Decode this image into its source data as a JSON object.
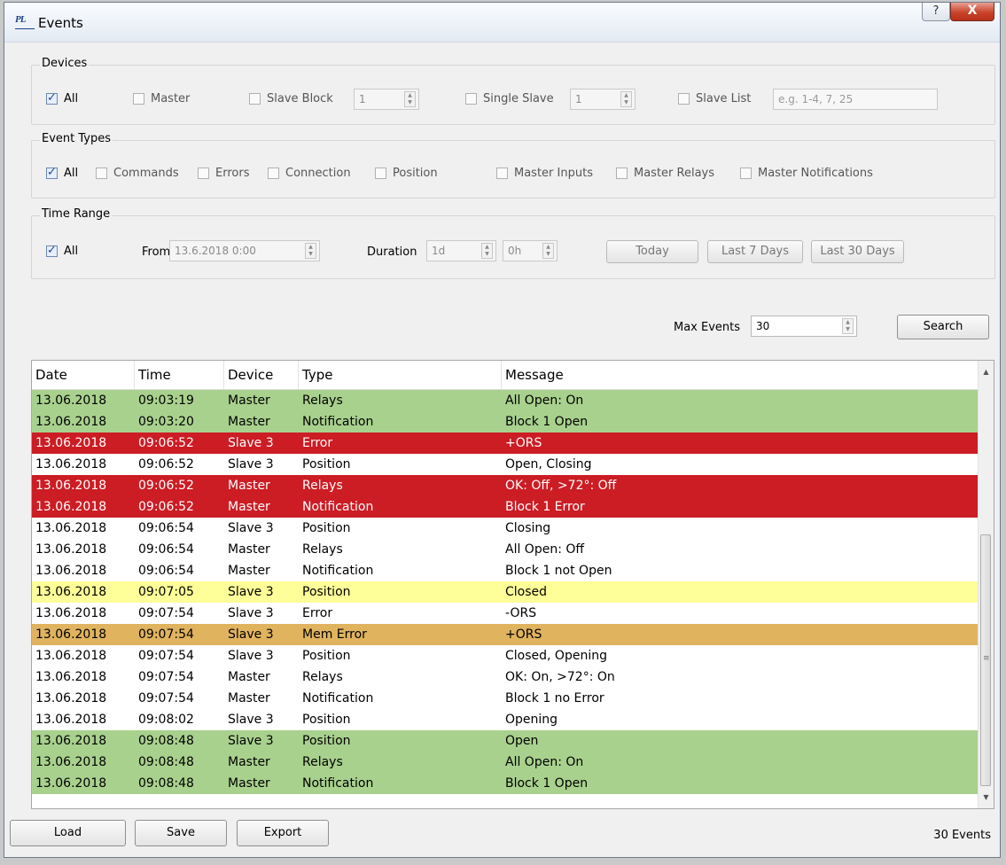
{
  "window": {
    "title": "Events",
    "logo_text": "PL",
    "help_label": "?",
    "close_label": "X"
  },
  "devices": {
    "label": "Devices",
    "all": "All",
    "master": "Master",
    "slave_block": "Slave Block",
    "slave_block_value": "1",
    "single_slave": "Single Slave",
    "single_slave_value": "1",
    "slave_list": "Slave List",
    "slave_list_placeholder": "e.g. 1-4, 7, 25"
  },
  "event_types": {
    "label": "Event Types",
    "all": "All",
    "commands": "Commands",
    "errors": "Errors",
    "connection": "Connection",
    "position": "Position",
    "master_inputs": "Master Inputs",
    "master_relays": "Master Relays",
    "master_notifications": "Master Notifications"
  },
  "time_range": {
    "label": "Time Range",
    "all": "All",
    "from_label": "From",
    "from_value": "13.6.2018 0:00",
    "duration_label": "Duration",
    "duration_days": "1d",
    "duration_hours": "0h",
    "today": "Today",
    "last7": "Last 7 Days",
    "last30": "Last 30 Days"
  },
  "search": {
    "max_events_label": "Max Events",
    "max_events_value": "30",
    "search_button": "Search"
  },
  "table": {
    "columns": [
      "Date",
      "Time",
      "Device",
      "Type",
      "Message"
    ],
    "rows": [
      {
        "date": "13.06.2018",
        "time": "09:03:19",
        "device": "Master",
        "type": "Relays",
        "message": "All Open: On",
        "color": "green"
      },
      {
        "date": "13.06.2018",
        "time": "09:03:20",
        "device": "Master",
        "type": "Notification",
        "message": "Block 1 Open",
        "color": "green"
      },
      {
        "date": "13.06.2018",
        "time": "09:06:52",
        "device": "Slave 3",
        "type": "Error",
        "message": "+ORS",
        "color": "red"
      },
      {
        "date": "13.06.2018",
        "time": "09:06:52",
        "device": "Slave 3",
        "type": "Position",
        "message": "Open, Closing",
        "color": "white"
      },
      {
        "date": "13.06.2018",
        "time": "09:06:52",
        "device": "Master",
        "type": "Relays",
        "message": "OK: Off, >72°: Off",
        "color": "red"
      },
      {
        "date": "13.06.2018",
        "time": "09:06:52",
        "device": "Master",
        "type": "Notification",
        "message": "Block 1 Error",
        "color": "red"
      },
      {
        "date": "13.06.2018",
        "time": "09:06:54",
        "device": "Slave 3",
        "type": "Position",
        "message": "Closing",
        "color": "white"
      },
      {
        "date": "13.06.2018",
        "time": "09:06:54",
        "device": "Master",
        "type": "Relays",
        "message": "All Open: Off",
        "color": "white"
      },
      {
        "date": "13.06.2018",
        "time": "09:06:54",
        "device": "Master",
        "type": "Notification",
        "message": "Block 1 not Open",
        "color": "white"
      },
      {
        "date": "13.06.2018",
        "time": "09:07:05",
        "device": "Slave 3",
        "type": "Position",
        "message": "Closed",
        "color": "yellow"
      },
      {
        "date": "13.06.2018",
        "time": "09:07:54",
        "device": "Slave 3",
        "type": "Error",
        "message": "-ORS",
        "color": "white"
      },
      {
        "date": "13.06.2018",
        "time": "09:07:54",
        "device": "Slave 3",
        "type": "Mem Error",
        "message": "+ORS",
        "color": "orange"
      },
      {
        "date": "13.06.2018",
        "time": "09:07:54",
        "device": "Slave 3",
        "type": "Position",
        "message": "Closed, Opening",
        "color": "white"
      },
      {
        "date": "13.06.2018",
        "time": "09:07:54",
        "device": "Master",
        "type": "Relays",
        "message": "OK: On, >72°: On",
        "color": "white"
      },
      {
        "date": "13.06.2018",
        "time": "09:07:54",
        "device": "Master",
        "type": "Notification",
        "message": "Block 1 no Error",
        "color": "white"
      },
      {
        "date": "13.06.2018",
        "time": "09:08:02",
        "device": "Slave 3",
        "type": "Position",
        "message": "Opening",
        "color": "white"
      },
      {
        "date": "13.06.2018",
        "time": "09:08:48",
        "device": "Slave 3",
        "type": "Position",
        "message": "Open",
        "color": "green"
      },
      {
        "date": "13.06.2018",
        "time": "09:08:48",
        "device": "Master",
        "type": "Relays",
        "message": "All Open: On",
        "color": "green"
      },
      {
        "date": "13.06.2018",
        "time": "09:08:48",
        "device": "Master",
        "type": "Notification",
        "message": "Block 1 Open",
        "color": "green"
      }
    ],
    "row_colors": {
      "green": "#a9d18e",
      "red": "#cc1c24",
      "yellow": "#ffff99",
      "orange": "#e0b35f",
      "white": "#ffffff"
    }
  },
  "footer": {
    "load": "Load",
    "save": "Save",
    "export": "Export",
    "count": "30 Events"
  }
}
